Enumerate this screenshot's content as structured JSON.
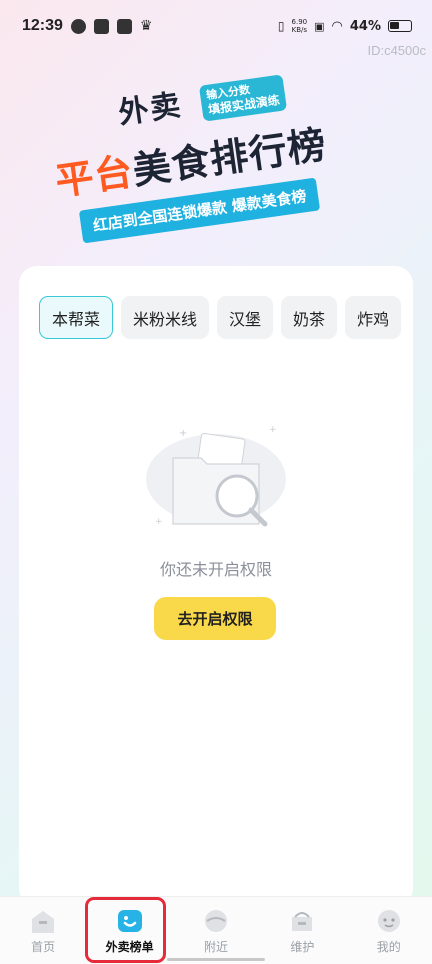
{
  "status_bar": {
    "time": "12:39",
    "speed_value": "6.90",
    "speed_unit": "KB/s",
    "battery": "44%"
  },
  "id_text": "ID:c4500c",
  "banner": {
    "line1": "外卖",
    "tag_line1": "输入分数",
    "tag_line2": "填报实战演练",
    "line2_highlight": "平台",
    "line2_rest": "美食排行榜",
    "ribbon": "红店到全国连锁爆款  爆款美食榜"
  },
  "tabs": [
    {
      "label": "本帮菜",
      "active": true
    },
    {
      "label": "米粉米线",
      "active": false
    },
    {
      "label": "汉堡",
      "active": false
    },
    {
      "label": "奶茶",
      "active": false
    },
    {
      "label": "炸鸡",
      "active": false
    }
  ],
  "empty_state": {
    "message": "你还未开启权限",
    "button_label": "去开启权限"
  },
  "bottom_nav": [
    {
      "label": "首页",
      "icon": "home-icon",
      "active": false
    },
    {
      "label": "外卖榜单",
      "icon": "ranking-icon",
      "active": true
    },
    {
      "label": "附近",
      "icon": "nearby-icon",
      "active": false
    },
    {
      "label": "维护",
      "icon": "maintain-icon",
      "active": false
    },
    {
      "label": "我的",
      "icon": "profile-icon",
      "active": false
    }
  ],
  "colors": {
    "accent": "#38c8d8",
    "button_yellow": "#f9d949",
    "highlight_red": "#e52a3a",
    "banner_orange": "#ff5a1f"
  }
}
